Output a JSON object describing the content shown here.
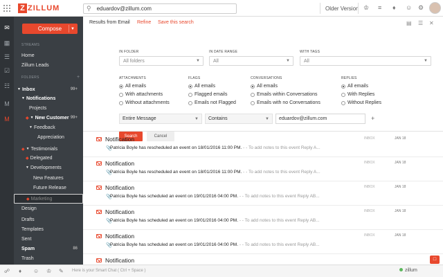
{
  "app": {
    "logo_text": "ZILLUM",
    "logo_letter": "Z"
  },
  "topbar": {
    "search_value": "eduardov@zillum.com",
    "older_version": "Older Version"
  },
  "sidebar": {
    "compose": "Compose",
    "streams_label": "STREAMS",
    "folders_label": "FOLDERS",
    "items": [
      {
        "label": "Home"
      },
      {
        "label": "Zillum Leads"
      },
      {
        "label": "Inbox",
        "count": "99+"
      },
      {
        "label": "Notifications"
      },
      {
        "label": "Projects"
      },
      {
        "label": "New Customer",
        "count": "99+"
      },
      {
        "label": "Feedback"
      },
      {
        "label": "Appreciation"
      },
      {
        "label": "Testimonials"
      },
      {
        "label": "Delegated"
      },
      {
        "label": "Developments"
      },
      {
        "label": "New Features"
      },
      {
        "label": "Future Release"
      },
      {
        "label": "Marketing"
      },
      {
        "label": "Design"
      },
      {
        "label": "Drafts"
      },
      {
        "label": "Templates"
      },
      {
        "label": "Sent"
      },
      {
        "label": "Spam",
        "count": "86"
      },
      {
        "label": "Trash"
      }
    ]
  },
  "results": {
    "title": "Results from Email",
    "refine": "Refine",
    "save": "Save this search"
  },
  "filter": {
    "in_folder": {
      "label": "IN FOLDER",
      "value": "All folders"
    },
    "in_date_range": {
      "label": "IN DATE RANGE",
      "value": "All"
    },
    "with_tags": {
      "label": "WITH TAGS",
      "value": "All"
    },
    "attachments": {
      "label": "ATTACHMENTS",
      "options": [
        "All emails",
        "With attachments",
        "Without attachments"
      ]
    },
    "flags": {
      "label": "FLAGS",
      "options": [
        "All emails",
        "Flagged emails",
        "Emails not Flagged"
      ]
    },
    "conversations": {
      "label": "CONVERSATIONS",
      "options": [
        "All emails",
        "Emails within Conversations",
        "Emails with no Conversations"
      ]
    },
    "replies": {
      "label": "REPLIES",
      "options": [
        "All emails",
        "With Replies",
        "Without Replies"
      ]
    },
    "field": "Entire Message",
    "operator": "Contains",
    "query": "eduardov@zillum.com",
    "search_btn": "Search",
    "cancel_btn": "Cancel"
  },
  "emails": [
    {
      "subject": "Notification",
      "snippet": "Patricia Boyle has rescheduled an event on 18/01/2016 11:00 PM.",
      "meta": " - - To add notes to this event Reply A...",
      "folder": "INBOX",
      "date": "JAN 18"
    },
    {
      "subject": "Notification",
      "snippet": "Patricia Boyle has rescheduled an event on 18/01/2016 11:00 PM.",
      "meta": " - - To add notes to this event Reply A...",
      "folder": "INBOX",
      "date": "JAN 18"
    },
    {
      "subject": "Notification",
      "snippet": "Patricia Boyle has scheduled an event on 19/01/2016 04:00 PM.",
      "meta": " - - To add notes to this event Reply AB...",
      "folder": "INBOX",
      "date": "JAN 18"
    },
    {
      "subject": "Notification",
      "snippet": "Patricia Boyle has scheduled an event on 19/01/2016 04:00 PM.",
      "meta": " - - To add notes to this event Reply AB...",
      "folder": "INBOX",
      "date": "JAN 18"
    },
    {
      "subject": "Notification",
      "snippet": "Patricia Boyle has scheduled an event on 19/01/2016 04:00 PM.",
      "meta": " - - To add notes to this event Reply AB...",
      "folder": "INBOX",
      "date": "JAN 18"
    },
    {
      "subject": "Notification",
      "snippet": "",
      "meta": "",
      "folder": "",
      "date": ""
    }
  ],
  "bottombar": {
    "chat_placeholder": "Here is your Smart Chat ( Ctrl + Space )",
    "user": "zillum"
  }
}
